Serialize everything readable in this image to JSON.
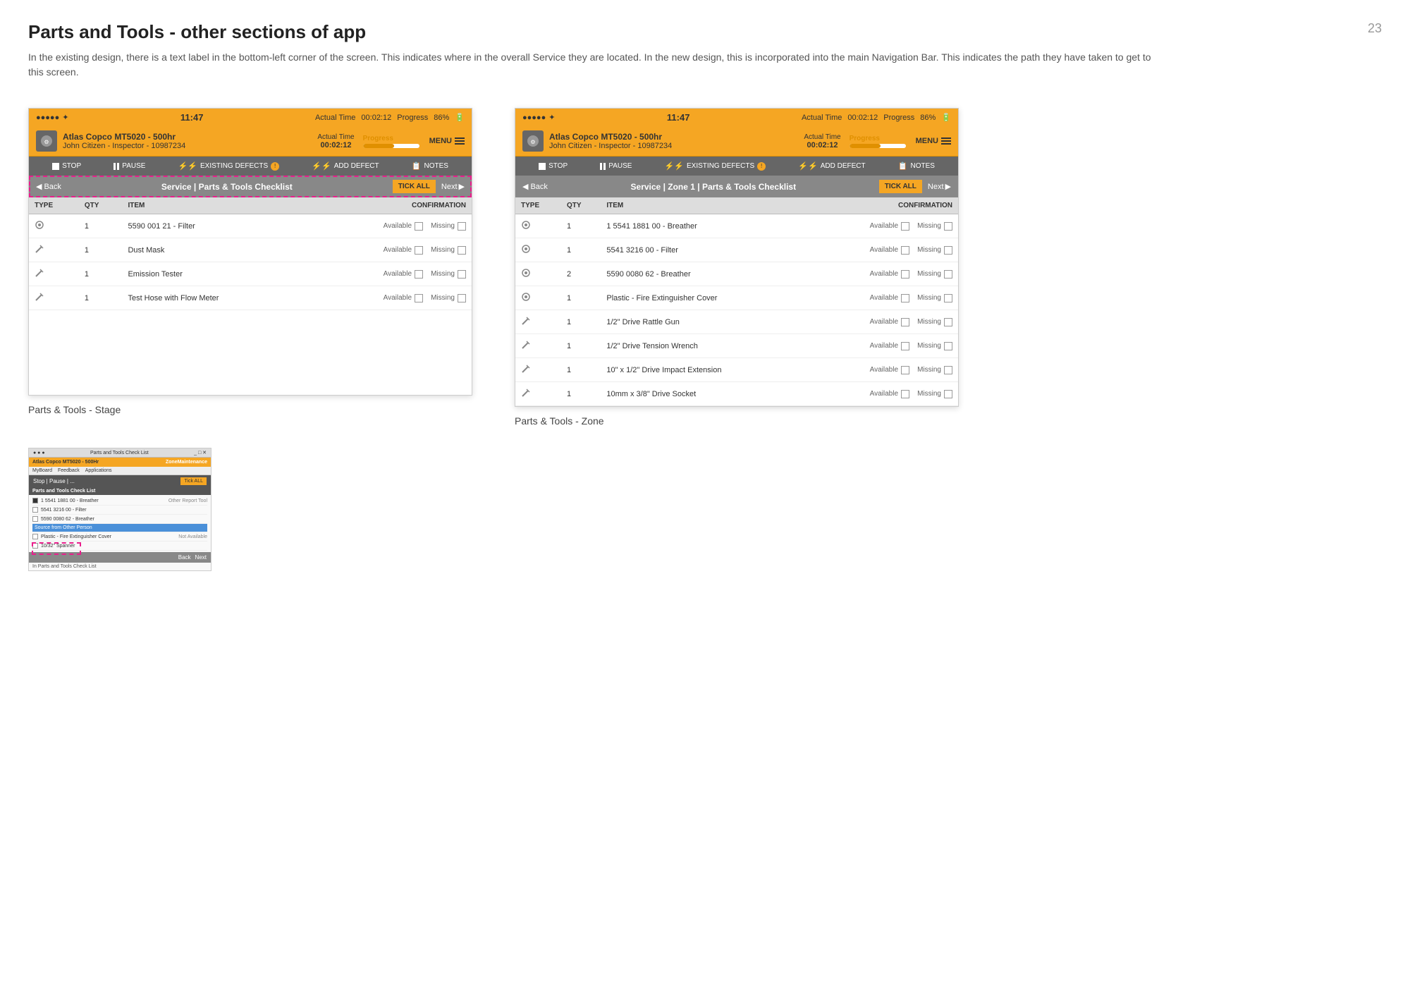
{
  "page": {
    "number": "23",
    "title": "Parts and Tools - other sections of app",
    "description": "In the existing design, there is a text label in the bottom-left corner of the screen. This indicates where in the overall Service they are located. In the new design, this is incorporated into the main Navigation Bar. This indicates the path they have taken to get to this screen."
  },
  "left_screen": {
    "status_bar": {
      "signals": "●●●●● ✦",
      "time": "11:47",
      "actual_time_label": "Actual Time",
      "actual_time_val": "00:02:12",
      "progress_label": "Progress",
      "progress_pct": 55,
      "battery": "86%",
      "menu_label": "MENU"
    },
    "header": {
      "machine": "Atlas Copco MT5020 - 500hr",
      "user": "John Citizen - Inspector - 10987234"
    },
    "actions": {
      "stop": "STOP",
      "pause": "PAUSE",
      "existing_defects": "EXISTING DEFECTS",
      "add_defect": "ADD DEFECT",
      "notes": "NOTES"
    },
    "nav": {
      "back": "< Back",
      "title": "Service  |  Parts & Tools Checklist",
      "tick_all": "TICK ALL",
      "next": "Next >"
    },
    "table": {
      "columns": [
        "TYPE",
        "QTY",
        "ITEM",
        "",
        "CONFIRMATION"
      ],
      "rows": [
        {
          "type": "gear",
          "qty": "1",
          "item": "5590 001 21 - Filter",
          "available": "Available",
          "missing": "Missing"
        },
        {
          "type": "tool",
          "qty": "1",
          "item": "Dust Mask",
          "available": "Available",
          "missing": "Missing"
        },
        {
          "type": "tool",
          "qty": "1",
          "item": "Emission Tester",
          "available": "Available",
          "missing": "Missing"
        },
        {
          "type": "tool",
          "qty": "1",
          "item": "Test Hose with Flow Meter",
          "available": "Available",
          "missing": "Missing"
        }
      ]
    },
    "label": "Parts & Tools - Stage"
  },
  "right_screen": {
    "status_bar": {
      "signals": "●●●●● ✦",
      "time": "11:47",
      "actual_time_label": "Actual Time",
      "actual_time_val": "00:02:12",
      "progress_label": "Progress",
      "progress_pct": 55,
      "battery": "86%",
      "menu_label": "MENU"
    },
    "header": {
      "machine": "Atlas Copco MT5020 - 500hr",
      "user": "John Citizen - Inspector - 10987234"
    },
    "actions": {
      "stop": "STOP",
      "pause": "PAUSE",
      "existing_defects": "EXISTING DEFECTS",
      "add_defect": "ADD DEFECT",
      "notes": "NOTES"
    },
    "nav": {
      "back": "< Back",
      "title": "Service  |  Zone 1  |  Parts & Tools Checklist",
      "tick_all": "TICK ALL",
      "next": "Next >"
    },
    "table": {
      "columns": [
        "TYPE",
        "QTY",
        "ITEM",
        "",
        "CONFIRMATION"
      ],
      "rows": [
        {
          "type": "gear",
          "qty": "1",
          "item": "1 5541 1881 00 - Breather",
          "available": "Available",
          "missing": "Missing"
        },
        {
          "type": "gear",
          "qty": "1",
          "item": "5541 3216 00 - Filter",
          "available": "Available",
          "missing": "Missing"
        },
        {
          "type": "gear",
          "qty": "2",
          "item": "5590 0080 62 - Breather",
          "available": "Available",
          "missing": "Missing"
        },
        {
          "type": "gear",
          "qty": "1",
          "item": "Plastic - Fire Extinguisher Cover",
          "available": "Available",
          "missing": "Missing"
        },
        {
          "type": "tool",
          "qty": "1",
          "item": "1/2\" Drive Rattle Gun",
          "available": "Available",
          "missing": "Missing"
        },
        {
          "type": "tool",
          "qty": "1",
          "item": "1/2\" Drive Tension Wrench",
          "available": "Available",
          "missing": "Missing"
        },
        {
          "type": "tool",
          "qty": "1",
          "item": "10\" x 1/2\" Drive Impact Extension",
          "available": "Available",
          "missing": "Missing"
        },
        {
          "type": "tool",
          "qty": "1",
          "item": "10mm x 3/8\" Drive Socket",
          "available": "Available",
          "missing": "Missing"
        }
      ]
    },
    "label": "Parts & Tools - Zone"
  },
  "legacy_screen": {
    "window_title": "Parts and Tools Check List",
    "header": "Atlas Copco MT5020 - 500Hr",
    "toolbar_right": "Tick ALL",
    "rows": [
      {
        "label": "1 5541 1881 00 - Breather",
        "checked": true,
        "note": "Other Report Tool"
      },
      {
        "label": "5541 3216 00 - Filter",
        "checked": false,
        "note": ""
      },
      {
        "label": "5590 0080 62 - Breather",
        "checked": false,
        "note": ""
      },
      {
        "label": "Plastic - Fire Extinguisher Cover",
        "checked": false,
        "note": "Not Available"
      },
      {
        "label": "10/32\" Spanner",
        "checked": false,
        "note": ""
      }
    ],
    "highlighted_section": "Source from Other Person",
    "nav_back": "Back",
    "nav_next": "Next",
    "bottom_label": "In Parts and Tools Check List",
    "dashed_annotation": true
  }
}
